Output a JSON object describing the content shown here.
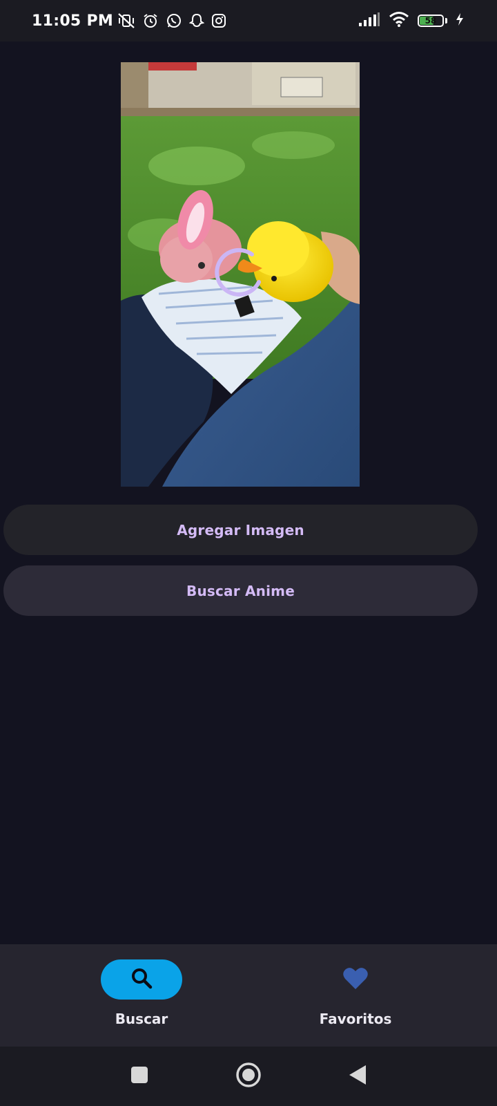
{
  "status_bar": {
    "time": "11:05 PM",
    "left_icons": [
      "vibrate-off-icon",
      "alarm-icon",
      "whatsapp-icon",
      "snapchat-icon",
      "instagram-icon"
    ],
    "battery_level": "58",
    "battery_fraction": 0.58,
    "right_icons": [
      "signal-icon",
      "wifi-icon",
      "battery-icon",
      "charging-icon"
    ]
  },
  "photo": {
    "subject": "pink bunny and yellow duck plush toys on a sleeve",
    "loading": true
  },
  "buttons": {
    "add_image": "Agregar Imagen",
    "search_anime": "Buscar Anime"
  },
  "bottom_nav": {
    "items": [
      {
        "label": "Buscar",
        "icon": "search-icon",
        "active": true
      },
      {
        "label": "Favoritos",
        "icon": "heart-icon",
        "active": false
      }
    ]
  },
  "colors": {
    "background": "#131320",
    "button_text": "#d4bbf6",
    "nav_active": "#0aa3e8",
    "heart": "#3a5fb0",
    "loading_ring": "#cbb6f5"
  }
}
